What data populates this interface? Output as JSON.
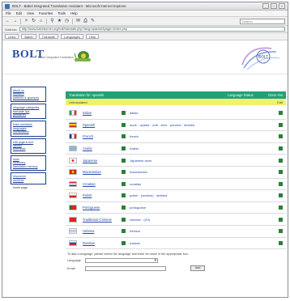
{
  "window": {
    "title": "BOLT - Babel Integrated Translation Assistant - Microsoft Internet Explorer",
    "buttons": [
      "_",
      "□",
      "×"
    ]
  },
  "menubar": {
    "items": [
      "File",
      "Edit",
      "View",
      "Favorites",
      "Tools",
      "Help"
    ]
  },
  "toolbar": {
    "search_placeholder": "Search"
  },
  "addressbar": {
    "label": "Address",
    "url": "http://www.babelserver.org/bolt/translate.php?lang=spanish&page=/index.php"
  },
  "linksbar": {
    "labels": [
      "Links",
      "Babel",
      "Translate",
      "Languages",
      "Help"
    ]
  },
  "header": {
    "logo": "BOLT",
    "logo_sub": "Babel Integrated Translation"
  },
  "sidebar": {
    "groups": [
      [
        "about us",
        "statistics",
        "partners & sponsors"
      ],
      [
        "language categories",
        "translate tips",
        "glossaries"
      ],
      [
        "team members",
        "languages",
        "coordinators"
      ],
      [
        "edit page & text",
        "upload",
        "download"
      ],
      [
        "tools",
        "dictionary",
        "translation memory"
      ],
      [
        "resources",
        "archives"
      ]
    ],
    "plain_items": [
      "home page"
    ]
  },
  "table": {
    "header_title": "Translation for: spanish",
    "col_language": "Language Status",
    "col_done": "Done Yes",
    "yellow_left": "Untranslated",
    "yellow_right": "Edit"
  },
  "languages": [
    {
      "name": "Italian",
      "links": "italian",
      "flag": "italy"
    },
    {
      "name": "Spanish",
      "links": "done · update · edit · view · preview · deleted",
      "flag": "spain"
    },
    {
      "name": "French",
      "links": "french",
      "flag": "france"
    },
    {
      "name": "Arabic",
      "links": "Arabic",
      "flag": "arabic"
    },
    {
      "name": "Japanese",
      "links": "Japanese done",
      "flag": "japan"
    },
    {
      "name": "Macedonian",
      "links": "macedonian",
      "flag": "macedonia"
    },
    {
      "name": "Croatian",
      "links": "croatian",
      "flag": "croatia"
    },
    {
      "name": "Polish",
      "links": "polish · (archive) · deleted",
      "flag": "poland"
    },
    {
      "name": "Portuguese",
      "links": "portuguese",
      "flag": "portugal"
    },
    {
      "name": "Traditional Chinese",
      "links": "chinese · (ZH)",
      "flag": "china"
    },
    {
      "name": "Hebrew",
      "links": "hebrew",
      "flag": "israel"
    },
    {
      "name": "Russian",
      "links": "russian",
      "flag": "russia"
    }
  ],
  "footer": {
    "text": "To add a language, please select the language and enter its name in the appropriate box.",
    "language_label": "Language",
    "email_label": "Email",
    "submit_label": "Add"
  }
}
